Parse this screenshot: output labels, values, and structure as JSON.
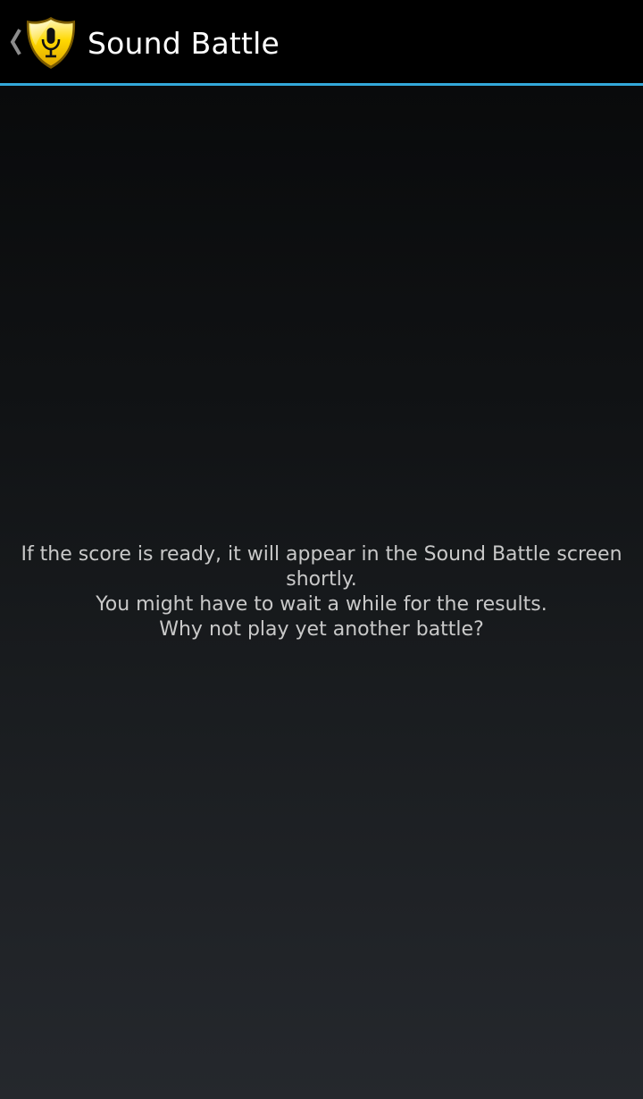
{
  "action_bar": {
    "title": "Sound Battle",
    "up_icon": "chevron-left-icon",
    "app_icon": "microphone-shield-icon",
    "divider_color": "#33a8da",
    "background": "#000000"
  },
  "message": {
    "line1": "If the score is ready, it will appear in the Sound Battle screen shortly.",
    "line2": "You might have to wait a while for the results.",
    "line3": "Why not play yet another battle?",
    "color": "#c9c9c9"
  }
}
